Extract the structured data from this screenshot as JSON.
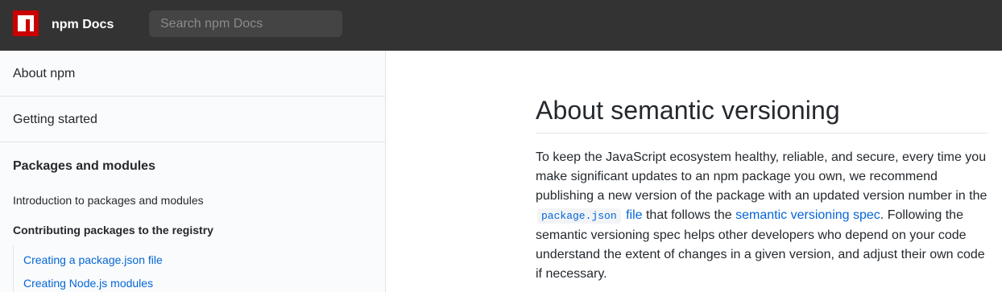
{
  "header": {
    "brand": "npm Docs",
    "search_placeholder": "Search npm Docs",
    "logo_color": "#cb0000"
  },
  "sidebar": {
    "top_items": [
      {
        "label": "About npm"
      },
      {
        "label": "Getting started"
      }
    ],
    "section": {
      "label": "Packages and modules",
      "items": [
        {
          "label": "Introduction to packages and modules"
        },
        {
          "label": "Contributing packages to the registry"
        }
      ],
      "children": [
        {
          "label": "Creating a package.json file"
        },
        {
          "label": "Creating Node.js modules"
        }
      ]
    }
  },
  "main": {
    "title": "About semantic versioning",
    "paragraph": {
      "text_1": "To keep the JavaScript ecosystem healthy, reliable, and secure, every time you make significant updates to an npm package you own, we recommend publishing a new version of the package with an updated version number in the ",
      "code": "package.json",
      "link_1": "file",
      "text_2": " that follows the ",
      "link_2": "semantic versioning spec",
      "text_3": ". Following the semantic versioning spec helps other developers who depend on your code understand the extent of changes in a given version, and adjust their own code if necessary."
    }
  },
  "colors": {
    "header_bg": "#333333",
    "link": "#0366d6",
    "sidebar_bg": "#fafbfc"
  }
}
